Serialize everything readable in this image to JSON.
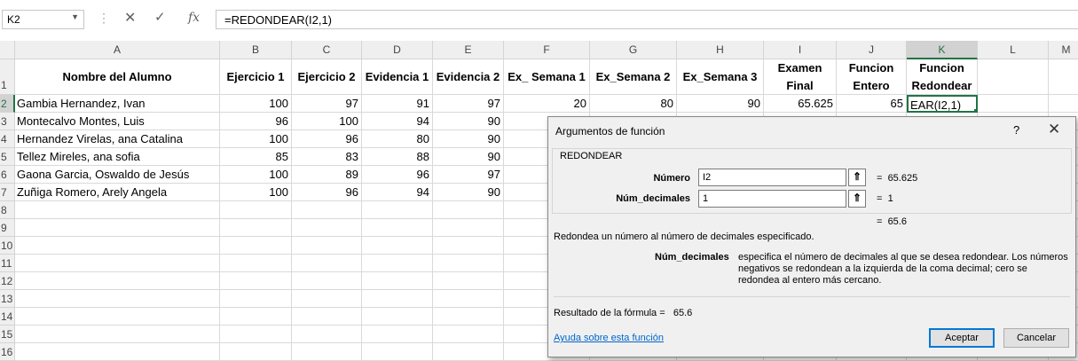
{
  "formula_bar": {
    "name_box": "K2",
    "cancel_glyph": "✕",
    "enter_glyph": "✓",
    "fx_label": "fx",
    "formula": "=REDONDEAR(I2,1)"
  },
  "columns": [
    "A",
    "B",
    "C",
    "D",
    "E",
    "F",
    "G",
    "H",
    "I",
    "J",
    "K",
    "L",
    "M"
  ],
  "selected_column": "K",
  "rows": [
    "1",
    "2",
    "3",
    "4",
    "5",
    "6",
    "7",
    "8",
    "9",
    "10",
    "11",
    "12",
    "13",
    "14",
    "15",
    "16"
  ],
  "selected_row": "2",
  "headers": {
    "A": "Nombre del Alumno",
    "B": "Ejercicio 1",
    "C": "Ejercicio 2",
    "D": "Evidencia 1",
    "E": "Evidencia 2",
    "F": "Ex_ Semana 1",
    "G": "Ex_Semana 2",
    "H": "Ex_Semana 3",
    "I": "Examen Final",
    "J": "Funcion Entero",
    "K": "Funcion Redondear"
  },
  "data_rows": [
    {
      "name": "Gambia Hernandez, Ivan",
      "b": "100",
      "c": "97",
      "d": "91",
      "e": "97",
      "f": "20",
      "g": "80",
      "h": "90",
      "i": "65.625",
      "j": "65",
      "k": "EAR(I2,1)"
    },
    {
      "name": "Montecalvo Montes, Luis",
      "b": "96",
      "c": "100",
      "d": "94",
      "e": "90"
    },
    {
      "name": "Hernandez Virelas, ana Catalina",
      "b": "100",
      "c": "96",
      "d": "80",
      "e": "90"
    },
    {
      "name": "Tellez Mireles, ana sofia",
      "b": "85",
      "c": "83",
      "d": "88",
      "e": "90"
    },
    {
      "name": "Gaona Garcia, Oswaldo de Jesús",
      "b": "100",
      "c": "89",
      "d": "96",
      "e": "97"
    },
    {
      "name": "Zuñiga Romero, Arely Angela",
      "b": "100",
      "c": "96",
      "d": "94",
      "e": "90"
    }
  ],
  "dialog": {
    "title": "Argumentos de función",
    "help": "?",
    "close": "✕",
    "function_name": "REDONDEAR",
    "args": [
      {
        "label": "Número",
        "input": "I2",
        "result": "65.625"
      },
      {
        "label": "Núm_decimales",
        "input": "1",
        "result": "1"
      }
    ],
    "equals": "=",
    "ref_button_glyph": "⇑",
    "function_result": "65.6",
    "description": "Redondea un número al número de decimales especificado.",
    "arg_name": "Núm_decimales",
    "arg_description": "especifica el número de decimales al que se desea redondear. Los números negativos se redondean a la izquierda de la coma decimal; cero se redondea al entero más cercano.",
    "formula_result_label": "Resultado de la fórmula =",
    "formula_result": "65.6",
    "help_link": "Ayuda sobre esta función",
    "ok_label": "Aceptar",
    "cancel_label": "Cancelar"
  }
}
